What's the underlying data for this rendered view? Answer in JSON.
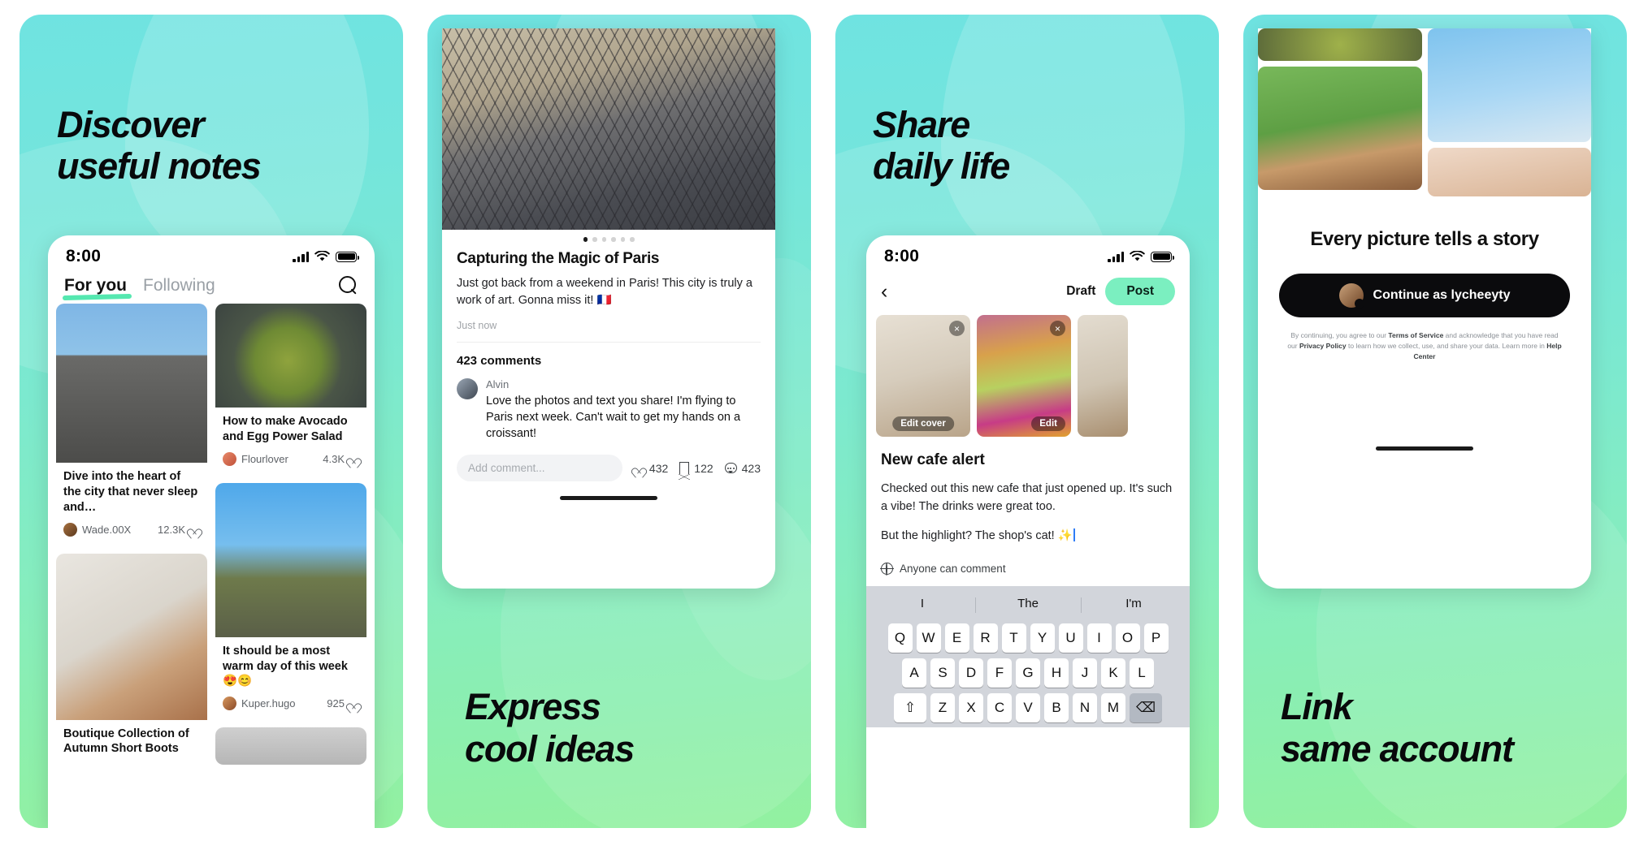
{
  "panels": [
    {
      "headline": "Discover\nuseful notes",
      "phone": {
        "clock": "8:00",
        "tabs": [
          {
            "label": "For you",
            "active": true
          },
          {
            "label": "Following",
            "active": false
          }
        ],
        "search_icon": "search-icon",
        "cards": [
          {
            "title": "Dive into the heart of the city that never sleep and…",
            "user": "Wade.00X",
            "likes": "12.3K"
          },
          {
            "title": "How to make Avocado and Egg Power Salad",
            "user": "Flourlover",
            "likes": "4.3K"
          },
          {
            "title": "It should be a most warm day of this week 😍😊",
            "user": "Kuper.hugo",
            "likes": "925"
          },
          {
            "title": "Boutique Collection of Autumn Short Boots",
            "user": "",
            "likes": ""
          }
        ]
      }
    },
    {
      "headline": "Express\ncool ideas",
      "phone": {
        "dots_total": 6,
        "dots_active": 1,
        "title": "Capturing the Magic of Paris",
        "body": "Just got back from a weekend in Paris! This city is truly a work of art. Gonna miss it! 🇫🇷",
        "time": "Just now",
        "comment_count": "423 comments",
        "comment": {
          "name": "Alvin",
          "text": "Love the photos and text you share! I'm flying to Paris next week. Can't wait to get my hands on a croissant!"
        },
        "add_comment_placeholder": "Add comment...",
        "actions": {
          "likes": "432",
          "bookmarks": "122",
          "comments": "423"
        }
      }
    },
    {
      "headline": "Share\ndaily life",
      "phone": {
        "clock": "8:00",
        "back_icon": "chevron-left-icon",
        "draft_label": "Draft",
        "post_label": "Post",
        "thumbnails": [
          {
            "caption": "Edit cover",
            "close": "×"
          },
          {
            "caption": "Edit",
            "close": "×"
          },
          {
            "caption": "",
            "close": ""
          }
        ],
        "title": "New cafe alert",
        "paragraph_1": "Checked out this new cafe that just opened up. It's such a vibe! The drinks were great too.",
        "paragraph_2": "But the highlight? The shop's cat! ✨",
        "permission": "Anyone can comment",
        "keyboard": {
          "predictions": [
            "I",
            "The",
            "I'm"
          ],
          "row1": [
            "Q",
            "W",
            "E",
            "R",
            "T",
            "Y",
            "U",
            "I",
            "O",
            "P"
          ],
          "row2": [
            "A",
            "S",
            "D",
            "F",
            "G",
            "H",
            "J",
            "K",
            "L"
          ],
          "row3": [
            "⇧",
            "Z",
            "X",
            "C",
            "V",
            "B",
            "N",
            "M",
            "⌫"
          ]
        }
      }
    },
    {
      "headline": "Link\nsame account",
      "phone": {
        "title": "Every picture tells a story",
        "continue_label": "Continue as lycheeyty",
        "fine_print_1": "By continuing, you agree to our ",
        "terms_label": "Terms of Service",
        "fine_print_2": " and acknowledge that you have read our ",
        "privacy_label": "Privacy Policy",
        "fine_print_3": " to learn how we collect, use, and share your data. Learn more in ",
        "help_label": "Help Center",
        "fine_print_4": ""
      }
    }
  ],
  "colors": {
    "gradient_top": "#6FE3E1",
    "gradient_bottom": "#93F1A0",
    "accent_mint": "#7BEFC0",
    "tab_underline": "#55E8B0",
    "text_dark": "#111111",
    "text_muted": "#9AA0A6",
    "button_dark": "#0B0B0D"
  }
}
